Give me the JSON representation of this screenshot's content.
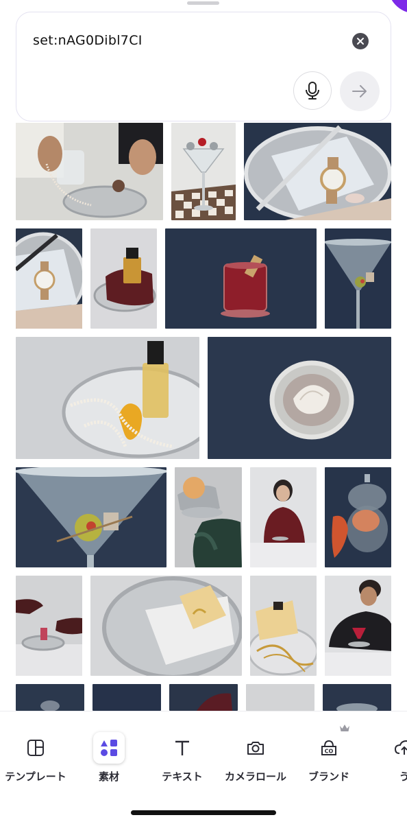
{
  "search": {
    "query": "set:nAG0Dibl7CI",
    "clear_icon": "close-icon",
    "mic_icon": "microphone-icon",
    "submit_icon": "arrow-right-icon"
  },
  "results": {
    "rows": [
      [
        "hands-with-pearls-and-glassware",
        "martini-on-chessboard",
        "watch-on-silver-tray-with-knife"
      ],
      [
        "watch-on-silver-tray",
        "perfume-on-leather-bag",
        "red-drink-in-glass",
        "martini-with-olive"
      ],
      [
        "perfume-bottle-with-pearls-on-tray",
        "seashell-on-silver-tray"
      ],
      [
        "martini-glass-closeup",
        "pastry-in-silver-cup-with-gloves",
        "woman-in-burgundy-jacket",
        "candy-jar-with-fruit"
      ],
      [
        "gloved-hands-with-tray",
        "butter-on-silver-tray",
        "butter-with-gold-chains",
        "man-pouring-drink"
      ]
    ]
  },
  "tabs": [
    {
      "label": "テンプレート",
      "icon": "layout-icon"
    },
    {
      "label": "素材",
      "icon": "elements-icon",
      "active": true
    },
    {
      "label": "テキスト",
      "icon": "text-icon"
    },
    {
      "label": "カメラロール",
      "icon": "camera-icon"
    },
    {
      "label": "ブランド",
      "icon": "brand-icon",
      "premium_icon": "crown-icon"
    },
    {
      "label": "う",
      "icon": "upload-icon"
    }
  ],
  "colors": {
    "accent": "#7d2ae8",
    "active_tab_icon": "#5b4be3",
    "navy_backdrop": "#2e3a4f",
    "grey_backdrop": "#c9ccd0"
  }
}
